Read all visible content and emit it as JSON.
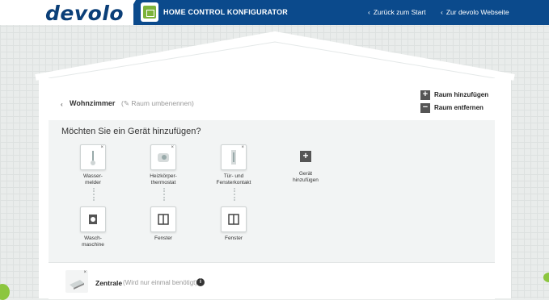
{
  "header": {
    "logo_text": "devolo",
    "app_title": "HOME CONTROL KONFIGURATOR",
    "back_to_start": "Zurück zum Start",
    "to_website": "Zur devolo Webseite",
    "chevron": "‹",
    "brand_color": "#0b4a8c"
  },
  "room": {
    "back_chevron": "‹",
    "name": "Wohnzimmer",
    "rename": "(✎ Raum umbenennen)",
    "add_room": "Raum hinzufügen",
    "remove_room": "Raum entfernen",
    "plus": "+",
    "minus": "−"
  },
  "devices": {
    "question": "Möchten Sie ein Gerät hinzufügen?",
    "remove_mark": "×",
    "top_row": [
      {
        "label": "Wasser-\nmelder",
        "icon": "water-sensor-icon"
      },
      {
        "label": "Heizkörper-\nthermostat",
        "icon": "thermostat-icon"
      },
      {
        "label": "Tür- und\nFensterkontakt",
        "icon": "door-contact-icon"
      }
    ],
    "add_device": {
      "label": "Gerät\nhinzufügen",
      "symbol": "+"
    },
    "bottom_row": [
      {
        "label": "Wasch-\nmaschine",
        "icon": "washing-machine-icon"
      },
      {
        "label": "Fenster",
        "icon": "window-icon"
      },
      {
        "label": "Fenster",
        "icon": "window-icon"
      }
    ]
  },
  "zentrale": {
    "label": "Zentrale",
    "note": "(Wird nur einmal benötigt)",
    "info": "i"
  }
}
